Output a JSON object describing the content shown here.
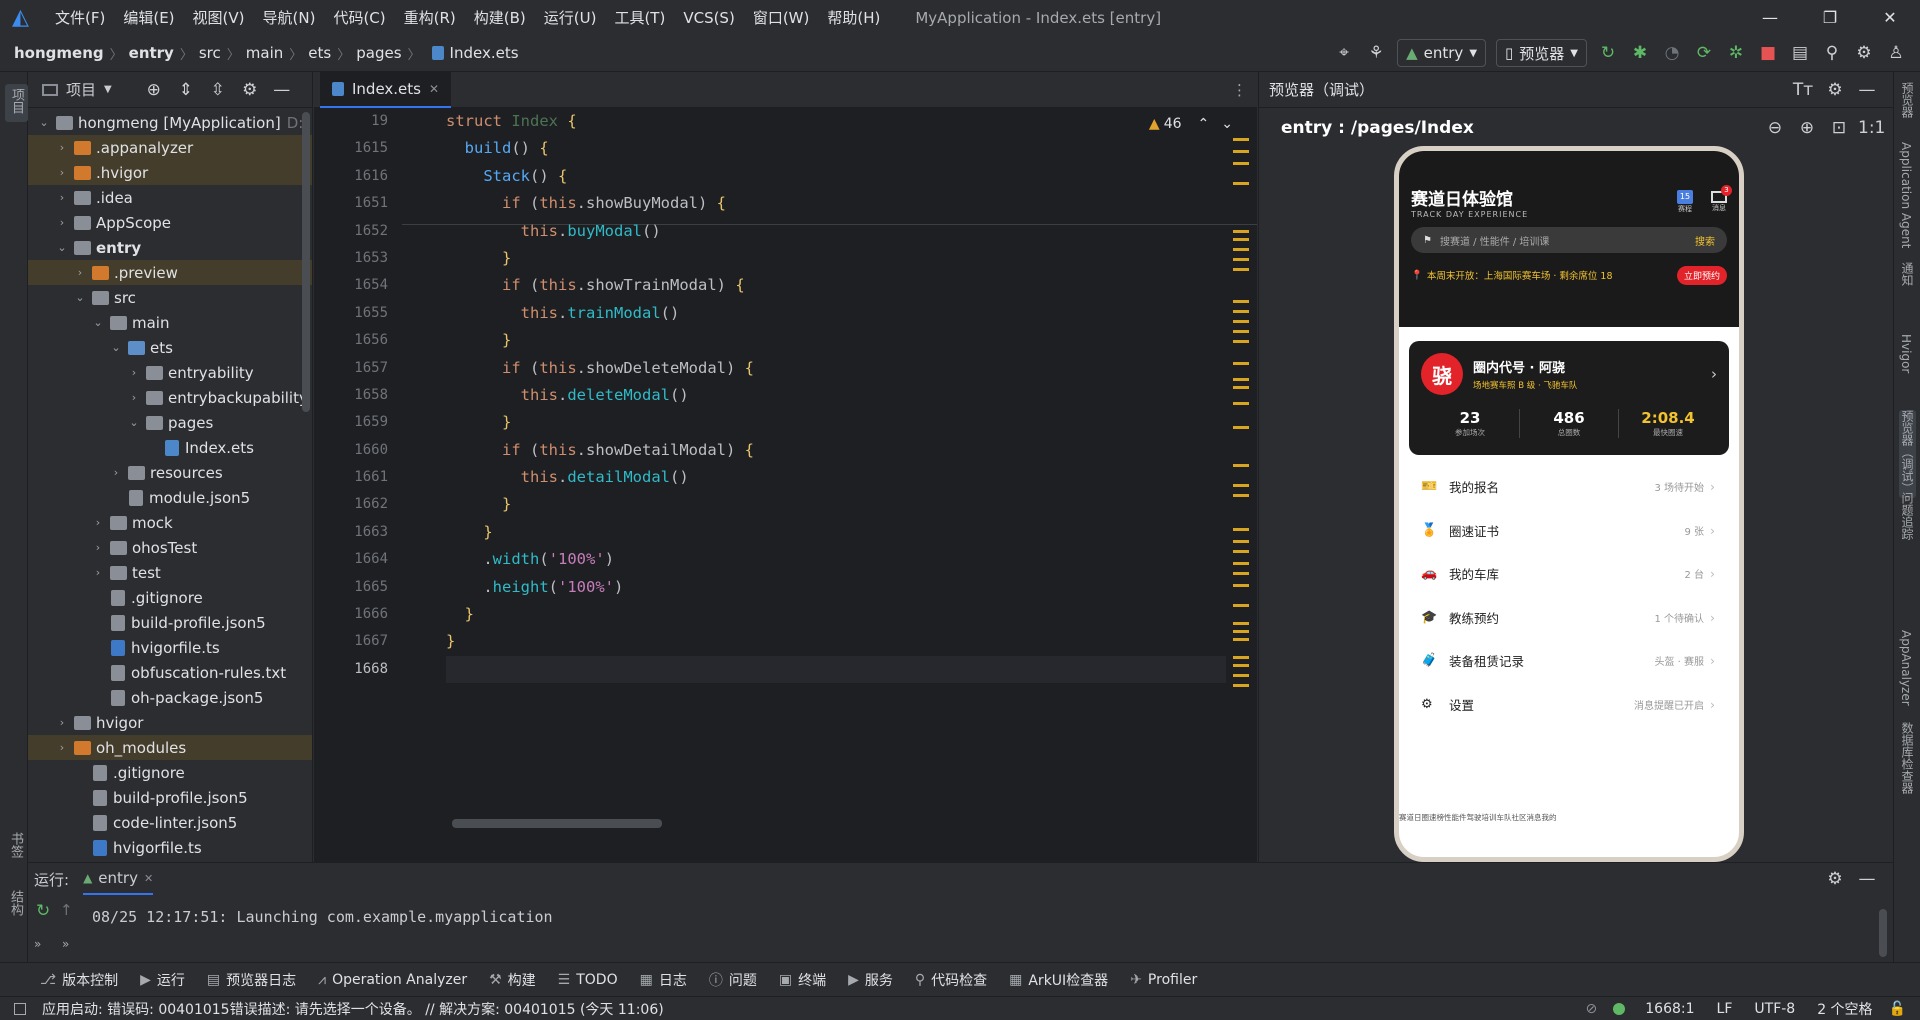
{
  "window": {
    "title": "MyApplication - Index.ets [entry]",
    "menu": [
      "文件(F)",
      "编辑(E)",
      "视图(V)",
      "导航(N)",
      "代码(C)",
      "重构(R)",
      "构建(B)",
      "运行(U)",
      "工具(T)",
      "VCS(S)",
      "窗口(W)",
      "帮助(H)"
    ]
  },
  "breadcrumb": [
    "hongmeng",
    "entry",
    "src",
    "main",
    "ets",
    "pages",
    "Index.ets"
  ],
  "toolbar": {
    "run_config": "entry",
    "device": "预览器"
  },
  "left_strip": {
    "top": "项目",
    "bottom_1": "书签",
    "bottom_2": "结构"
  },
  "project": {
    "title": "项目",
    "tree": [
      {
        "label": "hongmeng [MyApplication]",
        "suffix": "D:",
        "depth": 0,
        "type": "folder",
        "expanded": true
      },
      {
        "label": ".appanalyzer",
        "depth": 1,
        "type": "folder-o",
        "hl": true
      },
      {
        "label": ".hvigor",
        "depth": 1,
        "type": "folder-o",
        "hl": true
      },
      {
        "label": ".idea",
        "depth": 1,
        "type": "folder"
      },
      {
        "label": "AppScope",
        "depth": 1,
        "type": "folder"
      },
      {
        "label": "entry",
        "depth": 1,
        "type": "folder",
        "expanded": true,
        "bold": true
      },
      {
        "label": ".preview",
        "depth": 2,
        "type": "folder-o",
        "hl": true
      },
      {
        "label": "src",
        "depth": 2,
        "type": "folder",
        "expanded": true
      },
      {
        "label": "main",
        "depth": 3,
        "type": "folder",
        "expanded": true
      },
      {
        "label": "ets",
        "depth": 4,
        "type": "folder-b",
        "expanded": true
      },
      {
        "label": "entryability",
        "depth": 5,
        "type": "folder"
      },
      {
        "label": "entrybackupability",
        "depth": 5,
        "type": "folder"
      },
      {
        "label": "pages",
        "depth": 5,
        "type": "folder",
        "expanded": true
      },
      {
        "label": "Index.ets",
        "depth": 6,
        "type": "ets",
        "noarrow": true
      },
      {
        "label": "resources",
        "depth": 4,
        "type": "folder"
      },
      {
        "label": "module.json5",
        "depth": 4,
        "type": "file",
        "noarrow": true
      },
      {
        "label": "mock",
        "depth": 3,
        "type": "folder"
      },
      {
        "label": "ohosTest",
        "depth": 3,
        "type": "folder"
      },
      {
        "label": "test",
        "depth": 3,
        "type": "folder"
      },
      {
        "label": ".gitignore",
        "depth": 3,
        "type": "file",
        "noarrow": true
      },
      {
        "label": "build-profile.json5",
        "depth": 3,
        "type": "file",
        "noarrow": true
      },
      {
        "label": "hvigorfile.ts",
        "depth": 3,
        "type": "ts",
        "noarrow": true
      },
      {
        "label": "obfuscation-rules.txt",
        "depth": 3,
        "type": "file",
        "noarrow": true
      },
      {
        "label": "oh-package.json5",
        "depth": 3,
        "type": "file",
        "noarrow": true
      },
      {
        "label": "hvigor",
        "depth": 1,
        "type": "folder"
      },
      {
        "label": "oh_modules",
        "depth": 1,
        "type": "folder-o",
        "hl": true
      },
      {
        "label": ".gitignore",
        "depth": 2,
        "type": "file",
        "noarrow": true
      },
      {
        "label": "build-profile.json5",
        "depth": 2,
        "type": "file",
        "noarrow": true
      },
      {
        "label": "code-linter.json5",
        "depth": 2,
        "type": "file",
        "noarrow": true
      },
      {
        "label": "hvigorfile.ts",
        "depth": 2,
        "type": "ts",
        "noarrow": true
      }
    ]
  },
  "editor": {
    "tab": "Index.ets",
    "warnings": "46",
    "line_numbers": [
      "19",
      "1615",
      "1616",
      "1651",
      "1652",
      "1653",
      "1654",
      "1655",
      "1656",
      "1657",
      "1658",
      "1659",
      "1660",
      "1661",
      "1662",
      "1663",
      "1664",
      "1665",
      "1666",
      "1667",
      "1668"
    ]
  },
  "preview": {
    "title": "预览器（调试）",
    "route": "entry : /pages/Index",
    "app": {
      "title": "赛道日体验馆",
      "subtitle": "TRACK DAY EXPERIENCE",
      "icon1_label": "赛程",
      "icon1_badge": "15",
      "icon2_label": "消息",
      "icon2_badge": "3",
      "search_placeholder": "搜赛道 / 性能件 / 培训课",
      "search_button": "搜索",
      "banner_text": "本周末开放：上海国际赛车场 · 剩余席位 18",
      "banner_button": "立即预约",
      "avatar_char": "骁",
      "user_name": "圈内代号 · 阿骁",
      "user_desc": "场地赛车照 B 级 · 飞驰车队",
      "stats": [
        {
          "value": "23",
          "label": "参加场次"
        },
        {
          "value": "486",
          "label": "总圈数"
        },
        {
          "value": "2:08.4",
          "label": "最快圈速"
        }
      ],
      "menu": [
        {
          "label": "我的报名",
          "right": "3 场待开始",
          "icon": "🎫"
        },
        {
          "label": "圈速证书",
          "right": "9 张",
          "icon": "🏅"
        },
        {
          "label": "我的车库",
          "right": "2 台",
          "icon": "🚗"
        },
        {
          "label": "教练预约",
          "right": "1 个待确认",
          "icon": "🎓"
        },
        {
          "label": "装备租赁记录",
          "right": "头盔 · 赛服",
          "icon": "🧳"
        },
        {
          "label": "设置",
          "right": "消息提醒已开启",
          "icon": "⚙"
        }
      ],
      "bottom_nav": "赛道日圈速榜性能件驾驶培训车队社区消息我的"
    }
  },
  "run": {
    "label": "运行:",
    "tab": "entry",
    "log": "08/25 12:17:51: Launching com.example.myapplication"
  },
  "bottom_tools": [
    "版本控制",
    "运行",
    "预览器日志",
    "Operation Analyzer",
    "构建",
    "TODO",
    "日志",
    "问题",
    "终端",
    "服务",
    "代码检查",
    "ArkUI检查器",
    "Profiler"
  ],
  "status": {
    "message": "应用启动: 错误码: 00401015错误描述: 请先选择一个设备。 // 解决方案: 00401015 (今天 11:06)",
    "position": "1668:1",
    "line_sep": "LF",
    "encoding": "UTF-8",
    "indent": "2 个空格"
  },
  "right_strip": [
    "预览器",
    "Application Agent",
    "通知",
    "Hvigor",
    "预览器（调试）",
    "问题追踪",
    "AppAnalyzer",
    "数据库检查器"
  ]
}
